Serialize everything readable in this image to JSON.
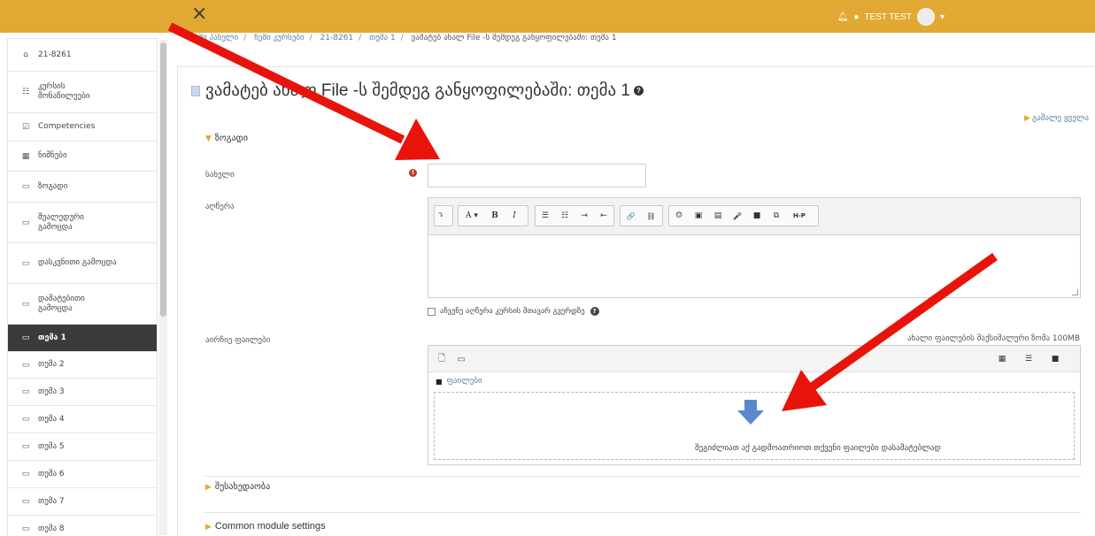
{
  "topbar": {
    "close_glyph": "×",
    "user_name": "TEST TEST",
    "bell_icon": "bell-icon",
    "chat_icon": "chat-icon",
    "dropdown_glyph": "▾"
  },
  "breadcrumb": {
    "items": [
      "ჩემი პანელი",
      "ჩემი კურსები",
      "21-8261",
      "თემა 1",
      "ვამატებ ახალ File -ს შემდეგ განყოფილებაში: თემა 1"
    ]
  },
  "sidebar": {
    "items": [
      {
        "label": "21-8261",
        "icon": "graduation-cap-icon",
        "glyph": "🎓"
      },
      {
        "label": "კურსის მონაწილეები",
        "icon": "users-icon",
        "glyph": "👥"
      },
      {
        "label": "Competencies",
        "icon": "check-square-icon",
        "glyph": "☑"
      },
      {
        "label": "ნიშნები",
        "icon": "table-icon",
        "glyph": "▦"
      },
      {
        "label": "ზოგადი",
        "icon": "folder-icon",
        "glyph": "▭"
      },
      {
        "label": "შუალედური გამოცდა",
        "icon": "folder-icon",
        "glyph": "▭"
      },
      {
        "label": "დასკვნითი გამოცდა",
        "icon": "folder-icon",
        "glyph": "▭"
      },
      {
        "label": "დამატებითი გამოცდა",
        "icon": "folder-icon",
        "glyph": "▭"
      },
      {
        "label": "თემა 1",
        "icon": "folder-icon",
        "glyph": "▭",
        "active": true
      },
      {
        "label": "თემა 2",
        "icon": "folder-icon",
        "glyph": "▭"
      },
      {
        "label": "თემა 3",
        "icon": "folder-icon",
        "glyph": "▭"
      },
      {
        "label": "თემა 4",
        "icon": "folder-icon",
        "glyph": "▭"
      },
      {
        "label": "თემა 5",
        "icon": "folder-icon",
        "glyph": "▭"
      },
      {
        "label": "თემა 6",
        "icon": "folder-icon",
        "glyph": "▭"
      },
      {
        "label": "თემა 7",
        "icon": "folder-icon",
        "glyph": "▭"
      },
      {
        "label": "თემა 8",
        "icon": "folder-icon",
        "glyph": "▭"
      }
    ]
  },
  "page": {
    "title": "ვამატებ ახალ File -ს შემდეგ განყოფილებაში: თემა 1",
    "expand_all": "გაშალე ყველა"
  },
  "sections": {
    "general": "ზოგადი",
    "restrict": "შესახედაობა",
    "common": "Common module settings"
  },
  "form": {
    "name_label": "სახელი",
    "name_value": "",
    "description_label": "აღწერა",
    "show_description": "აჩვენე აღწერა კურსის მთავარ გვერდზე",
    "files_label": "აირჩიე ფაილები",
    "max_size": "ახალი ფაილების მაქსიმალური ზომა 100MB"
  },
  "editor": {
    "toolbar_groups": [
      [
        "⤵"
      ],
      [
        "A ▾",
        "B",
        "I"
      ],
      [
        "☰",
        "☷",
        "⇥",
        "⇤"
      ],
      [
        "🔗",
        "⛓"
      ],
      [
        "☺",
        "▣",
        "▤",
        "🎤",
        "■",
        "⧉",
        "H-P"
      ]
    ]
  },
  "filemanager": {
    "path_root": "ფაილები",
    "drop_text": "შეგიძლიათ აქ გადმოათრიოთ თქვენი ფაილები დასამატებლად",
    "add_file_icon": "add-file-icon",
    "create_folder_icon": "create-folder-icon",
    "views": [
      "▦",
      "☰",
      "■"
    ]
  },
  "colors": {
    "accent": "#e1a934",
    "annotation": "#e8140c",
    "nav_active": "#3b3b3b",
    "required": "#c0392b"
  }
}
